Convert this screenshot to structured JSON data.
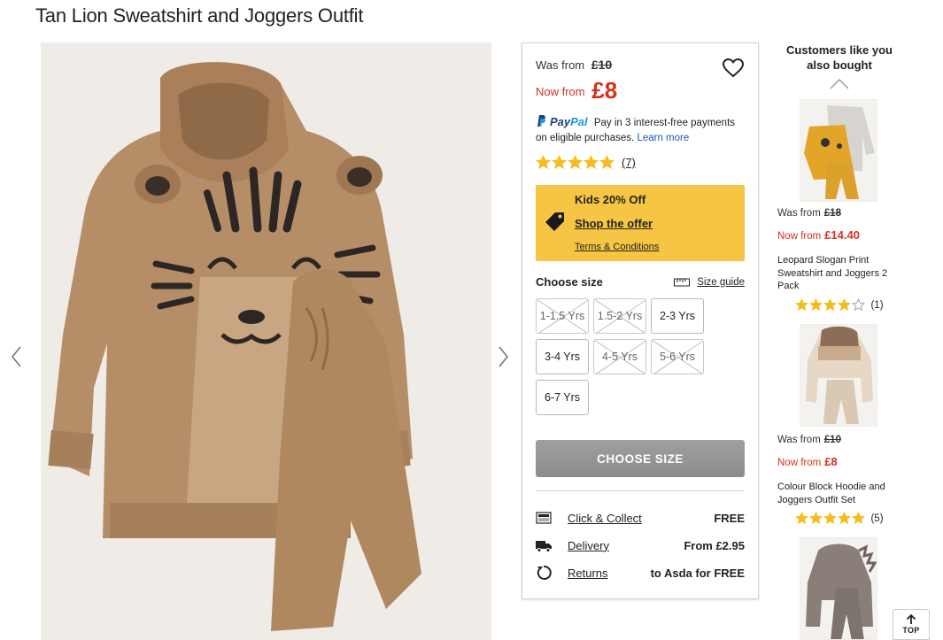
{
  "product": {
    "title": "Tan Lion Sweatshirt and Joggers Outfit",
    "was_label": "Was from",
    "was_price": "£10",
    "now_label": "Now from",
    "now_price": "£8",
    "rating_value": 5,
    "review_count": "(7)"
  },
  "paypal": {
    "brand_part1": "Pay",
    "brand_part2": "Pal",
    "message": "Pay in 3 interest-free payments on eligible purchases.",
    "link": "Learn more"
  },
  "offer": {
    "title": "Kids 20% Off",
    "shop_link": "Shop the offer",
    "terms_link": "Terms & Conditions"
  },
  "sizes": {
    "heading": "Choose size",
    "guide_label": "Size guide",
    "options": [
      {
        "label": "1-1.5 Yrs",
        "available": false
      },
      {
        "label": "1.5-2 Yrs",
        "available": false
      },
      {
        "label": "2-3 Yrs",
        "available": true
      },
      {
        "label": "3-4 Yrs",
        "available": true
      },
      {
        "label": "4-5 Yrs",
        "available": false
      },
      {
        "label": "5-6 Yrs",
        "available": false
      },
      {
        "label": "6-7 Yrs",
        "available": true
      }
    ],
    "choose_button": "CHOOSE SIZE"
  },
  "services": [
    {
      "icon": "click-collect-icon",
      "label": "Click & Collect",
      "value": "FREE"
    },
    {
      "icon": "delivery-truck-icon",
      "label": "Delivery",
      "value": "From £2.95"
    },
    {
      "icon": "returns-icon",
      "label": "Returns",
      "value": "to Asda for FREE"
    }
  ],
  "recommendations": {
    "title": "Customers like you also bought",
    "items": [
      {
        "was_label": "Was from",
        "was_price": "£18",
        "now_label": "Now from",
        "now_price": "£14.40",
        "name": "Leopard Slogan Print Sweatshirt and Joggers 2 Pack",
        "rating": 4,
        "reviews": "(1)"
      },
      {
        "was_label": "Was from",
        "was_price": "£10",
        "now_label": "Now from",
        "now_price": "£8",
        "name": "Colour Block Hoodie and Joggers Outfit Set",
        "rating": 5,
        "reviews": "(5)"
      },
      {
        "name": ""
      }
    ]
  },
  "back_to_top": "TOP",
  "colors": {
    "sale_red": "#d5311b",
    "offer_yellow": "#f6c543",
    "star_yellow": "#f3bd1e",
    "paypal_dark": "#253b80",
    "paypal_light": "#179bd7",
    "button_grey": "#959595",
    "sweatshirt_tan": "#b58d67"
  }
}
